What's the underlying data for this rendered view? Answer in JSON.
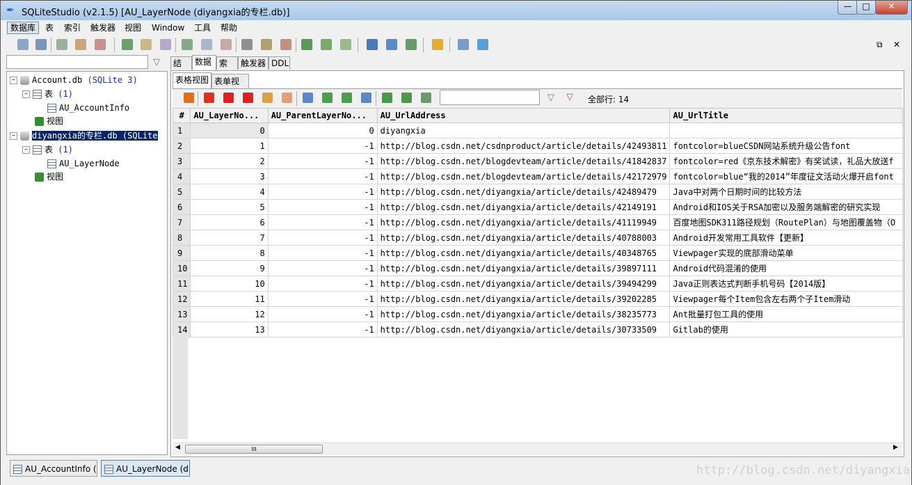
{
  "window": {
    "title": "SQLiteStudio (v2.1.5) [AU_LayerNode (diyangxia的专栏.db)]",
    "min_label": "—",
    "max_label": "□",
    "close_label": "✕"
  },
  "menu": [
    "数据库",
    "表",
    "索引",
    "触发器",
    "视图",
    "Window",
    "工具",
    "帮助"
  ],
  "tree": {
    "db1_name": "Account.db",
    "db1_type": "(SQLite 3)",
    "db1_tables": "表",
    "db1_tables_count": "(1)",
    "db1_table1": "AU_AccountInfo",
    "db1_views": "视图",
    "db2_name": "diyangxia的专栏.db (SQLite",
    "db2_tables": "表",
    "db2_tables_count": "(1)",
    "db2_table1": "AU_LayerNode",
    "db2_views": "视图"
  },
  "tabs": [
    "结构",
    "数据",
    "索引",
    "触发器",
    "DDL"
  ],
  "subtabs": [
    "表格视图",
    "表单视图"
  ],
  "grid_toolbar": {
    "total_label": "全部行: 14"
  },
  "grid": {
    "columns": [
      "#",
      "AU_LayerNo...",
      "AU_ParentLayerNo...",
      "AU_UrlAddress",
      "AU_UrlTitle"
    ],
    "rows": [
      [
        "1",
        "0",
        "0",
        "diyangxia",
        ""
      ],
      [
        "2",
        "1",
        "-1",
        "http://blog.csdn.net/csdnproduct/article/details/42493811",
        "fontcolor=blueCSDN网站系统升级公告font"
      ],
      [
        "3",
        "2",
        "-1",
        "http://blog.csdn.net/blogdevteam/article/details/41842837",
        "fontcolor=red《京东技术解密》有奖试读，礼品大放送f"
      ],
      [
        "4",
        "3",
        "-1",
        "http://blog.csdn.net/blogdevteam/article/details/42172979",
        "fontcolor=blue“我的2014”年度征文活动火爆开启font"
      ],
      [
        "5",
        "4",
        "-1",
        "http://blog.csdn.net/diyangxia/article/details/42489479",
        "Java中对两个日期时间的比较方法"
      ],
      [
        "6",
        "5",
        "-1",
        "http://blog.csdn.net/diyangxia/article/details/42149191",
        "Android和IOS关于RSA加密以及服务端解密的研究实现"
      ],
      [
        "7",
        "6",
        "-1",
        "http://blog.csdn.net/diyangxia/article/details/41119949",
        "百度地图SDK311路径规划（RoutePlan）与地图覆盖物（O"
      ],
      [
        "8",
        "7",
        "-1",
        "http://blog.csdn.net/diyangxia/article/details/40788003",
        "Android开发常用工具软件【更新】"
      ],
      [
        "9",
        "8",
        "-1",
        "http://blog.csdn.net/diyangxia/article/details/40348765",
        "Viewpager实现的底部滑动菜单"
      ],
      [
        "10",
        "9",
        "-1",
        "http://blog.csdn.net/diyangxia/article/details/39897111",
        "Android代码混淆的使用"
      ],
      [
        "11",
        "10",
        "-1",
        "http://blog.csdn.net/diyangxia/article/details/39494299",
        "Java正则表达式判断手机号码【2014版】"
      ],
      [
        "12",
        "11",
        "-1",
        "http://blog.csdn.net/diyangxia/article/details/39202285",
        "Viewpager每个Item包含左右两个子Item滑动"
      ],
      [
        "13",
        "12",
        "-1",
        "http://blog.csdn.net/diyangxia/article/details/38235773",
        "Ant批量打包工具的使用"
      ],
      [
        "14",
        "13",
        "-1",
        "http://blog.csdn.net/diyangxia/article/details/30733509",
        "Gitlab的使用"
      ]
    ]
  },
  "scroll_thumb_label": "III",
  "status_tabs": [
    "AU_AccountInfo (",
    "AU_LayerNode (di"
  ],
  "watermark": "http://blog.csdn.net/diyangxia"
}
